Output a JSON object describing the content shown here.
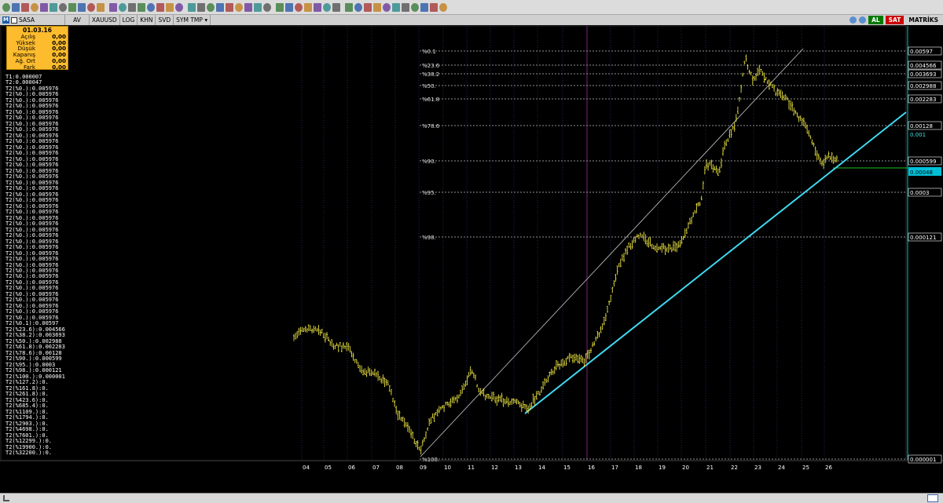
{
  "toolbar": {
    "icons": [
      "lock-icon",
      "cursor-icon",
      "crosshair-icon",
      "zoom-icon",
      "trendline-icon",
      "pencil-icon",
      "channel-icon",
      "fibonacci-icon",
      "text-icon",
      "rectangle-icon",
      "arrow-icon",
      "eraser-icon",
      "undo-icon",
      "redo-icon",
      "refresh-icon",
      "brush-icon",
      "copy-icon",
      "paste-icon",
      "print-icon",
      "bars-icon",
      "grid-icon",
      "indicator-icon",
      "stats-icon",
      "table-icon",
      "compare-icon",
      "chart-icon",
      "layout-icon",
      "color-icon",
      "ruler-icon",
      "magnet-icon",
      "cloud-icon",
      "palette-icon",
      "bookmark-icon",
      "note-icon",
      "alert-icon",
      "fit-icon",
      "expand-vertical-icon",
      "compress-icon",
      "center-icon",
      "left-icon",
      "right-icon",
      "up-icon",
      "down-icon",
      "zoom-in-icon",
      "zoom-out-icon",
      "help-icon"
    ]
  },
  "symbol_bar": {
    "symbol": "SASA",
    "period": "AV",
    "currency": "XAUUSD",
    "log": "LOG",
    "khn": "KHN",
    "svd": "SVD",
    "symtmp": "SYM TMP",
    "buy": "AL",
    "sell": "SAT",
    "brand": "MATRİKS"
  },
  "info_box": {
    "date": "01.03.16",
    "rows": [
      {
        "label": "Açılış",
        "value": "0,00"
      },
      {
        "label": "Yüksek",
        "value": "0,00"
      },
      {
        "label": "Düşük",
        "value": "0,00"
      },
      {
        "label": "Kapanış",
        "value": "0,00"
      },
      {
        "label": "Ağ. Ort",
        "value": "0,00"
      },
      {
        "label": "Fark",
        "value": "0,00"
      }
    ]
  },
  "trend_values": [
    "T1:0.000007",
    "T2:0.000047",
    "T2(%0.):0.005976",
    "T2(%0.):0.005976",
    "T2(%0.):0.005976",
    "T2(%0.):0.005976",
    "T2(%0.):0.005976",
    "T2(%0.):0.005976",
    "T2(%0.):0.005976",
    "T2(%0.):0.005976",
    "T2(%0.):0.005976",
    "T2(%0.):0.005976",
    "T2(%0.):0.005976",
    "T2(%0.):0.005976",
    "T2(%0.):0.005976",
    "T2(%0.):0.005976",
    "T2(%0.):0.005976",
    "T2(%0.):0.005976",
    "T2(%0.):0.005976",
    "T2(%0.):0.005976",
    "T2(%0.):0.005976",
    "T2(%0.):0.005976",
    "T2(%0.):0.005976",
    "T2(%0.):0.005976",
    "T2(%0.):0.005976",
    "T2(%0.):0.005976",
    "T2(%0.):0.005976",
    "T2(%0.):0.005976",
    "T2(%0.):0.005976",
    "T2(%0.):0.005976",
    "T2(%0.):0.005976",
    "T2(%0.):0.005976",
    "T2(%0.):0.005976",
    "T2(%0.):0.005976",
    "T2(%0.):0.005976",
    "T2(%0.):0.005976",
    "T2(%0.):0.005976",
    "T2(%0.):0.005976",
    "T2(%0.):0.005976",
    "T2(%0.):0.005976",
    "T2(%0.):0.005976",
    "T2(%0.):0.005976",
    "T2(%0.1):0.00597",
    "T2(%23.6):0.004566",
    "T2(%38.2):0.003693",
    "T2(%50.):0.002988",
    "T2(%61.8):0.002283",
    "T2(%78.6):0.00128",
    "T2(%90.):0.000599",
    "T2(%95.):0.0003",
    "T2(%98.):0.000121",
    "T2(%100.):0.000001",
    "T2(%127.2):0.",
    "T2(%161.8):0.",
    "T2(%261.8):0.",
    "T2(%423.6):0.",
    "T2(%685.4):0.",
    "T2(%1109.):0.",
    "T2(%1794.):0.",
    "T2(%2903.):0.",
    "T2(%4698.):0.",
    "T2(%7601.):0.",
    "T2(%12299.):0.",
    "T2(%19900.):0.",
    "T2(%32200.):0."
  ],
  "fib_levels": [
    {
      "label": "%0.1",
      "price": "0.00597"
    },
    {
      "label": "%23.6",
      "price": "0.004566"
    },
    {
      "label": "%38.2",
      "price": "0.003693"
    },
    {
      "label": "%50.",
      "price": "0.002988"
    },
    {
      "label": "%61.8",
      "price": "0.002283"
    },
    {
      "label": "%78.6",
      "price": "0.00128"
    },
    {
      "label": "%90.",
      "price": "0.000599"
    },
    {
      "label": "%95.",
      "price": "0.0003"
    },
    {
      "label": "%98.",
      "price": "0.000121"
    },
    {
      "label": "%100.",
      "price": "0.000001"
    }
  ],
  "axis_extra": {
    "trend_price": "0.001",
    "last_price": "0.00048"
  },
  "x_ticks": [
    "04",
    "05",
    "06",
    "07",
    "08",
    "09",
    "10",
    "11",
    "12",
    "13",
    "14",
    "15",
    "16",
    "17",
    "18",
    "19",
    "20",
    "21",
    "22",
    "23",
    "24",
    "25",
    "26"
  ],
  "colors": {
    "bars": "#e8e040",
    "support": "#40d8f0",
    "channel": "#c8c8c8",
    "grid": "#1a2a5a",
    "marker": "#7a1f7a",
    "fib": "#909090",
    "last": "#20c020"
  }
}
